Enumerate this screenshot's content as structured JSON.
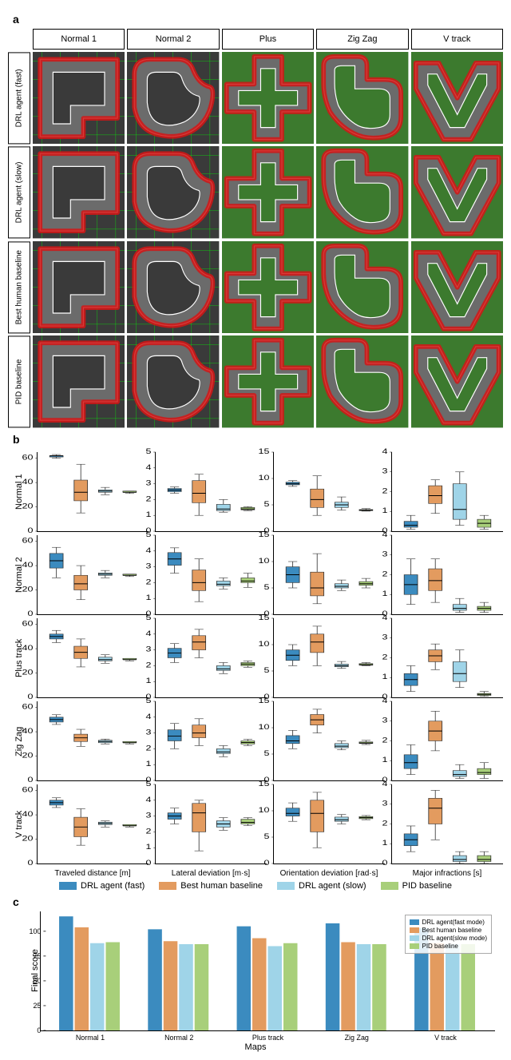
{
  "panel_a": {
    "label": "a",
    "columns": [
      "Normal 1",
      "Normal 2",
      "Plus",
      "Zig Zag",
      "V track"
    ],
    "rows": [
      "DRL agent (fast)",
      "DRL agent (slow)",
      "Best human baseline",
      "PID baseline"
    ]
  },
  "panel_b": {
    "label": "b",
    "rows": [
      "Normal 1",
      "Normal 2",
      "Plus track",
      "Zig Zag",
      "V track"
    ],
    "metrics": [
      "Traveled distance [m]",
      "Lateral deviation [m·s]",
      "Orientation deviation [rad·s]",
      "Major infractions [s]"
    ],
    "legend": [
      {
        "label": "DRL agent (fast)",
        "color": "#3b8bbf"
      },
      {
        "label": "Best human baseline",
        "color": "#e39b5f"
      },
      {
        "label": "DRL agent (slow)",
        "color": "#9fd4e8"
      },
      {
        "label": "PID baseline",
        "color": "#a8cf7a"
      }
    ]
  },
  "panel_c": {
    "label": "c",
    "ylabel": "Final score",
    "xlabel": "Maps",
    "legend": [
      {
        "label": "DRL agent(fast mode)",
        "color": "#3b8bbf"
      },
      {
        "label": "Best human baseline",
        "color": "#e39b5f"
      },
      {
        "label": "DRL agent(slow mode)",
        "color": "#9fd4e8"
      },
      {
        "label": "PID baseline",
        "color": "#a8cf7a"
      }
    ]
  },
  "chart_data": {
    "panel_b": {
      "type": "boxplot_grid",
      "metrics": [
        {
          "name": "Traveled distance [m]",
          "ylim": [
            0,
            65
          ],
          "ticks": [
            0,
            20,
            40,
            60
          ]
        },
        {
          "name": "Lateral deviation [m·s]",
          "ylim": [
            0,
            5
          ],
          "ticks": [
            0,
            1,
            2,
            3,
            4,
            5
          ]
        },
        {
          "name": "Orientation deviation [rad·s]",
          "ylim": [
            0,
            15
          ],
          "ticks": [
            0,
            5,
            10,
            15
          ]
        },
        {
          "name": "Major infractions [s]",
          "ylim": [
            0,
            4
          ],
          "ticks": [
            0,
            1,
            2,
            3,
            4
          ]
        }
      ],
      "series_order": [
        "DRL agent (fast)",
        "Best human baseline",
        "DRL agent (slow)",
        "PID baseline"
      ],
      "colors": [
        "#3b8bbf",
        "#e39b5f",
        "#9fd4e8",
        "#a8cf7a"
      ],
      "data": {
        "Normal 1": {
          "Traveled distance [m]": [
            {
              "min": 60,
              "q1": 61,
              "med": 62,
              "q3": 62,
              "max": 63
            },
            {
              "min": 15,
              "q1": 25,
              "med": 32,
              "q3": 42,
              "max": 55
            },
            {
              "min": 30,
              "q1": 32,
              "med": 33,
              "q3": 34,
              "max": 36
            },
            {
              "min": 31,
              "q1": 32,
              "med": 32,
              "q3": 33,
              "max": 33
            }
          ],
          "Lateral deviation [m·s]": [
            {
              "min": 2.4,
              "q1": 2.5,
              "med": 2.6,
              "q3": 2.7,
              "max": 2.8
            },
            {
              "min": 1.0,
              "q1": 1.8,
              "med": 2.4,
              "q3": 3.2,
              "max": 3.6
            },
            {
              "min": 1.2,
              "q1": 1.3,
              "med": 1.4,
              "q3": 1.7,
              "max": 2.0
            },
            {
              "min": 1.3,
              "q1": 1.35,
              "med": 1.4,
              "q3": 1.5,
              "max": 1.55
            }
          ],
          "Orientation deviation [rad·s]": [
            {
              "min": 8.5,
              "q1": 8.8,
              "med": 9.0,
              "q3": 9.3,
              "max": 9.6
            },
            {
              "min": 3.0,
              "q1": 4.5,
              "med": 6.0,
              "q3": 8.0,
              "max": 10.5
            },
            {
              "min": 4.0,
              "q1": 4.5,
              "med": 5.0,
              "q3": 5.5,
              "max": 6.5
            },
            {
              "min": 3.8,
              "q1": 3.9,
              "med": 4.0,
              "q3": 4.1,
              "max": 4.3
            }
          ],
          "Major infractions [s]": [
            {
              "min": 0.1,
              "q1": 0.2,
              "med": 0.3,
              "q3": 0.5,
              "max": 0.8
            },
            {
              "min": 0.9,
              "q1": 1.4,
              "med": 1.8,
              "q3": 2.3,
              "max": 2.6
            },
            {
              "min": 0.3,
              "q1": 0.6,
              "med": 1.1,
              "q3": 2.4,
              "max": 3.0
            },
            {
              "min": 0.1,
              "q1": 0.2,
              "med": 0.4,
              "q3": 0.6,
              "max": 0.8
            }
          ]
        },
        "Normal 2": {
          "Traveled distance [m]": [
            {
              "min": 30,
              "q1": 38,
              "med": 44,
              "q3": 50,
              "max": 55
            },
            {
              "min": 12,
              "q1": 20,
              "med": 25,
              "q3": 32,
              "max": 40
            },
            {
              "min": 30,
              "q1": 32,
              "med": 33,
              "q3": 34,
              "max": 36
            },
            {
              "min": 31,
              "q1": 32,
              "med": 32,
              "q3": 33,
              "max": 33
            }
          ],
          "Lateral deviation [m·s]": [
            {
              "min": 2.6,
              "q1": 3.1,
              "med": 3.5,
              "q3": 3.9,
              "max": 4.2
            },
            {
              "min": 0.8,
              "q1": 1.5,
              "med": 2.0,
              "q3": 2.8,
              "max": 3.5
            },
            {
              "min": 1.6,
              "q1": 1.8,
              "med": 1.9,
              "q3": 2.1,
              "max": 2.3
            },
            {
              "min": 1.7,
              "q1": 2.0,
              "med": 2.1,
              "q3": 2.3,
              "max": 2.6
            }
          ],
          "Orientation deviation [rad·s]": [
            {
              "min": 5.0,
              "q1": 6.0,
              "med": 7.5,
              "q3": 9.0,
              "max": 10.0
            },
            {
              "min": 2.0,
              "q1": 3.5,
              "med": 5.0,
              "q3": 8.0,
              "max": 11.5
            },
            {
              "min": 4.5,
              "q1": 5.0,
              "med": 5.3,
              "q3": 5.8,
              "max": 6.5
            },
            {
              "min": 5.0,
              "q1": 5.5,
              "med": 5.8,
              "q3": 6.2,
              "max": 6.8
            }
          ],
          "Major infractions [s]": [
            {
              "min": 0.5,
              "q1": 1.0,
              "med": 1.5,
              "q3": 2.0,
              "max": 2.8
            },
            {
              "min": 0.6,
              "q1": 1.2,
              "med": 1.7,
              "q3": 2.3,
              "max": 2.8
            },
            {
              "min": 0.1,
              "q1": 0.2,
              "med": 0.3,
              "q3": 0.5,
              "max": 0.8
            },
            {
              "min": 0.1,
              "q1": 0.2,
              "med": 0.3,
              "q3": 0.4,
              "max": 0.6
            }
          ]
        },
        "Plus track": {
          "Traveled distance [m]": [
            {
              "min": 45,
              "q1": 48,
              "med": 50,
              "q3": 52,
              "max": 55
            },
            {
              "min": 25,
              "q1": 32,
              "med": 37,
              "q3": 42,
              "max": 48
            },
            {
              "min": 28,
              "q1": 30,
              "med": 31,
              "q3": 33,
              "max": 35
            },
            {
              "min": 30,
              "q1": 31,
              "med": 31,
              "q3": 32,
              "max": 32
            }
          ],
          "Lateral deviation [m·s]": [
            {
              "min": 2.2,
              "q1": 2.5,
              "med": 2.8,
              "q3": 3.1,
              "max": 3.4
            },
            {
              "min": 2.5,
              "q1": 3.0,
              "med": 3.5,
              "q3": 3.9,
              "max": 4.3
            },
            {
              "min": 1.5,
              "q1": 1.7,
              "med": 1.8,
              "q3": 2.0,
              "max": 2.2
            },
            {
              "min": 1.9,
              "q1": 2.0,
              "med": 2.1,
              "q3": 2.2,
              "max": 2.3
            }
          ],
          "Orientation deviation [rad·s]": [
            {
              "min": 6.0,
              "q1": 7.0,
              "med": 8.0,
              "q3": 9.0,
              "max": 10.0
            },
            {
              "min": 6.0,
              "q1": 8.5,
              "med": 10.5,
              "q3": 12.0,
              "max": 13.5
            },
            {
              "min": 5.5,
              "q1": 5.8,
              "med": 6.0,
              "q3": 6.3,
              "max": 6.8
            },
            {
              "min": 6.0,
              "q1": 6.1,
              "med": 6.2,
              "q3": 6.4,
              "max": 6.6
            }
          ],
          "Major infractions [s]": [
            {
              "min": 0.3,
              "q1": 0.6,
              "med": 0.9,
              "q3": 1.2,
              "max": 1.6
            },
            {
              "min": 1.4,
              "q1": 1.8,
              "med": 2.1,
              "q3": 2.4,
              "max": 2.7
            },
            {
              "min": 0.5,
              "q1": 0.8,
              "med": 1.2,
              "q3": 1.8,
              "max": 2.4
            },
            {
              "min": 0.05,
              "q1": 0.1,
              "med": 0.15,
              "q3": 0.2,
              "max": 0.3
            }
          ]
        },
        "Zig Zag": {
          "Traveled distance [m]": [
            {
              "min": 46,
              "q1": 48,
              "med": 50,
              "q3": 52,
              "max": 54
            },
            {
              "min": 28,
              "q1": 32,
              "med": 35,
              "q3": 38,
              "max": 42
            },
            {
              "min": 30,
              "q1": 31,
              "med": 32,
              "q3": 33,
              "max": 34
            },
            {
              "min": 30,
              "q1": 31,
              "med": 31,
              "q3": 32,
              "max": 32
            }
          ],
          "Lateral deviation [m·s]": [
            {
              "min": 2.0,
              "q1": 2.5,
              "med": 2.8,
              "q3": 3.2,
              "max": 3.6
            },
            {
              "min": 2.2,
              "q1": 2.7,
              "med": 3.0,
              "q3": 3.5,
              "max": 3.9
            },
            {
              "min": 1.5,
              "q1": 1.7,
              "med": 1.8,
              "q3": 2.0,
              "max": 2.2
            },
            {
              "min": 2.2,
              "q1": 2.3,
              "med": 2.4,
              "q3": 2.5,
              "max": 2.6
            }
          ],
          "Orientation deviation [rad·s]": [
            {
              "min": 6.0,
              "q1": 7.0,
              "med": 7.5,
              "q3": 8.5,
              "max": 9.5
            },
            {
              "min": 9.0,
              "q1": 10.5,
              "med": 11.5,
              "q3": 12.5,
              "max": 13.5
            },
            {
              "min": 5.8,
              "q1": 6.2,
              "med": 6.5,
              "q3": 7.0,
              "max": 7.5
            },
            {
              "min": 6.8,
              "q1": 7.0,
              "med": 7.1,
              "q3": 7.3,
              "max": 7.6
            }
          ],
          "Major infractions [s]": [
            {
              "min": 0.3,
              "q1": 0.6,
              "med": 0.9,
              "q3": 1.3,
              "max": 1.8
            },
            {
              "min": 1.5,
              "q1": 2.0,
              "med": 2.5,
              "q3": 3.0,
              "max": 3.5
            },
            {
              "min": 0.1,
              "q1": 0.2,
              "med": 0.3,
              "q3": 0.5,
              "max": 0.8
            },
            {
              "min": 0.1,
              "q1": 0.3,
              "med": 0.4,
              "q3": 0.6,
              "max": 0.9
            }
          ]
        },
        "V track": {
          "Traveled distance [m]": [
            {
              "min": 46,
              "q1": 48,
              "med": 50,
              "q3": 52,
              "max": 54
            },
            {
              "min": 15,
              "q1": 22,
              "med": 30,
              "q3": 38,
              "max": 45
            },
            {
              "min": 30,
              "q1": 32,
              "med": 33,
              "q3": 34,
              "max": 35
            },
            {
              "min": 30,
              "q1": 31,
              "med": 31,
              "q3": 32,
              "max": 32
            }
          ],
          "Lateral deviation [m·s]": [
            {
              "min": 2.5,
              "q1": 2.8,
              "med": 3.0,
              "q3": 3.2,
              "max": 3.5
            },
            {
              "min": 0.8,
              "q1": 2.0,
              "med": 3.2,
              "q3": 3.8,
              "max": 4.0
            },
            {
              "min": 2.1,
              "q1": 2.3,
              "med": 2.5,
              "q3": 2.7,
              "max": 2.9
            },
            {
              "min": 2.4,
              "q1": 2.5,
              "med": 2.6,
              "q3": 2.8,
              "max": 2.9
            }
          ],
          "Orientation deviation [rad·s]": [
            {
              "min": 8.0,
              "q1": 9.0,
              "med": 9.5,
              "q3": 10.5,
              "max": 11.5
            },
            {
              "min": 3.0,
              "q1": 6.0,
              "med": 9.5,
              "q3": 12.0,
              "max": 13.5
            },
            {
              "min": 7.5,
              "q1": 8.0,
              "med": 8.3,
              "q3": 8.8,
              "max": 9.3
            },
            {
              "min": 8.3,
              "q1": 8.5,
              "med": 8.7,
              "q3": 8.9,
              "max": 9.1
            }
          ],
          "Major infractions [s]": [
            {
              "min": 0.6,
              "q1": 0.9,
              "med": 1.2,
              "q3": 1.5,
              "max": 1.9
            },
            {
              "min": 1.2,
              "q1": 2.0,
              "med": 2.8,
              "q3": 3.3,
              "max": 3.7
            },
            {
              "min": 0.0,
              "q1": 0.1,
              "med": 0.2,
              "q3": 0.4,
              "max": 0.6
            },
            {
              "min": 0.0,
              "q1": 0.1,
              "med": 0.2,
              "q3": 0.4,
              "max": 0.6
            }
          ]
        }
      }
    },
    "panel_c": {
      "type": "bar",
      "ylabel": "Final score",
      "xlabel": "Maps",
      "ylim": [
        0,
        120
      ],
      "yticks": [
        0,
        25,
        50,
        75,
        100
      ],
      "categories": [
        "Normal 1",
        "Normal 2",
        "Plus track",
        "Zig Zag",
        "V track"
      ],
      "series": [
        {
          "name": "DRL agent(fast mode)",
          "color": "#3b8bbf",
          "values": [
            115,
            102,
            105,
            108,
            103
          ]
        },
        {
          "name": "Best human baseline",
          "color": "#e39b5f",
          "values": [
            104,
            90,
            93,
            89,
            88
          ]
        },
        {
          "name": "DRL agent(slow mode)",
          "color": "#9fd4e8",
          "values": [
            88,
            87,
            85,
            87,
            87
          ]
        },
        {
          "name": "PID baseline",
          "color": "#a8cf7a",
          "values": [
            89,
            87,
            88,
            87,
            87
          ]
        }
      ]
    }
  }
}
